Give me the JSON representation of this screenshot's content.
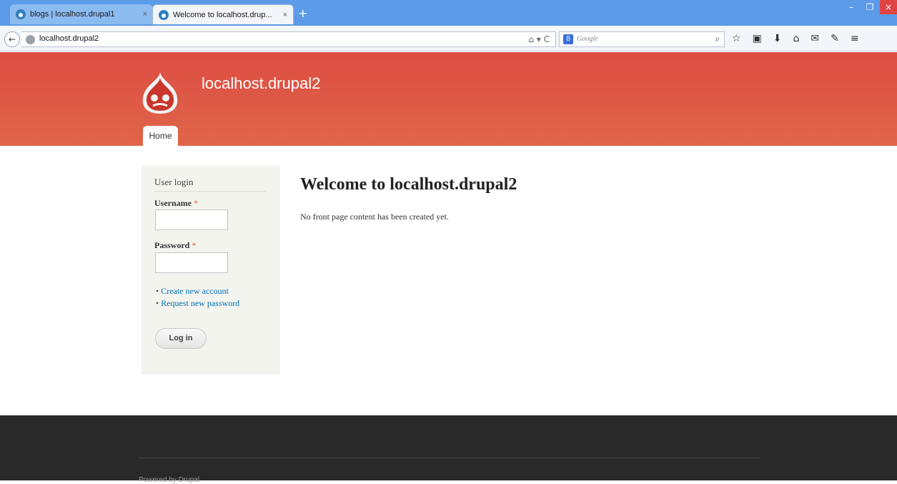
{
  "browser": {
    "tabs": [
      {
        "label": "blogs | localhost.drupal1",
        "close": "×"
      },
      {
        "label": "Welcome to localhost.drup...",
        "close": "×"
      }
    ],
    "new_tab": "+",
    "window_controls": {
      "minimize": "–",
      "maximize": "❐",
      "close": "×"
    },
    "back": "←",
    "url": "localhost.drupal2",
    "url_icons": "⌂ ▾ C",
    "search_engine_icon": "8",
    "search_placeholder": "Google",
    "search_icon": "⌕",
    "toolbar_icons": [
      "☆",
      "▣",
      "⬇",
      "⌂",
      "✉",
      "✎",
      "≡"
    ]
  },
  "site": {
    "name": "localhost.drupal2",
    "nav": {
      "home": "Home"
    }
  },
  "login_block": {
    "title": "User login",
    "username_label": "Username",
    "password_label": "Password",
    "required_marker": "*",
    "links": [
      "Create new account",
      "Request new password"
    ],
    "submit_label": "Log in"
  },
  "main": {
    "title": "Welcome to localhost.drupal2",
    "text": "No front page content has been created yet."
  },
  "footer": {
    "text": "Powered by Drupal"
  },
  "colors": {
    "header_start": "#dd4d42",
    "header_end": "#e0654a",
    "link": "#0071b3",
    "footer_bg": "#292929",
    "sidebar_bg": "#f4f4ef"
  }
}
